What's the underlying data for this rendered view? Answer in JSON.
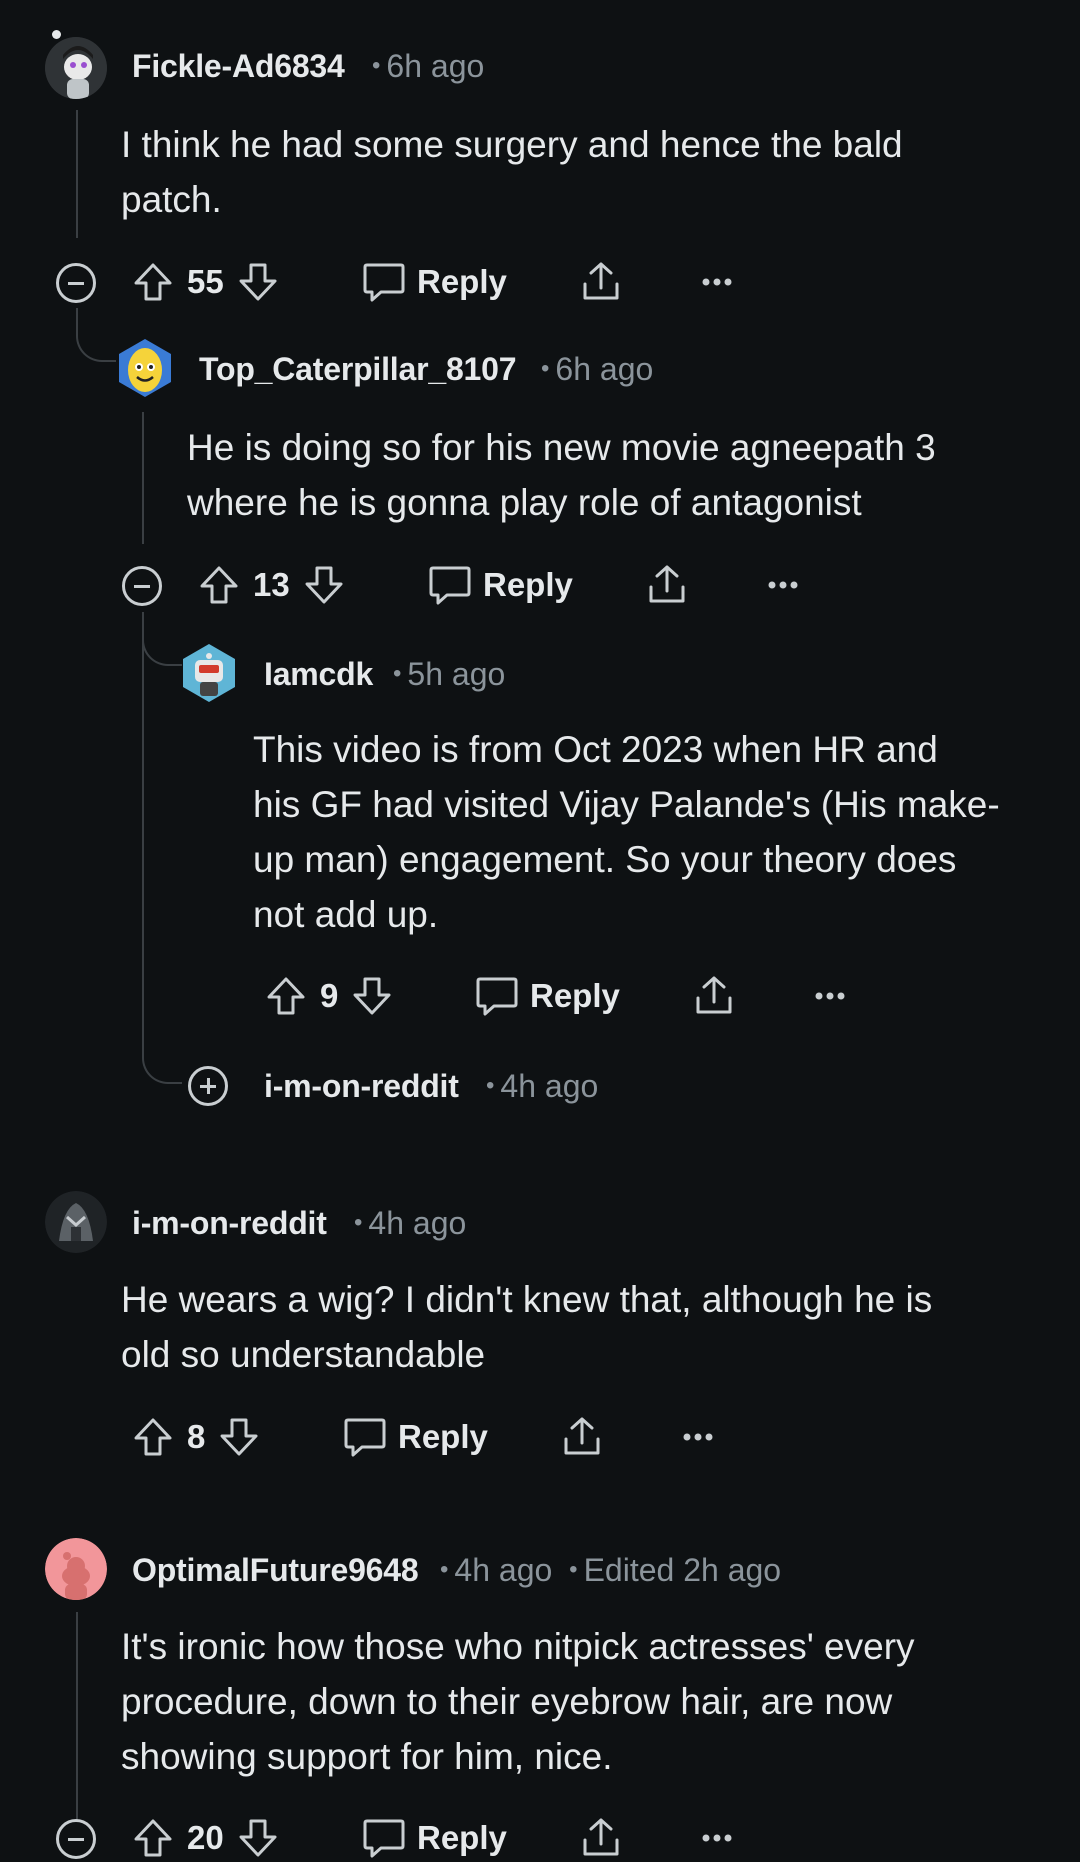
{
  "comments": [
    {
      "username": "Fickle-Ad6834",
      "time": "6h ago",
      "body_lines": [
        "I think he had some surgery and hence the bald",
        "patch."
      ],
      "votes": "55",
      "reply_label": "Reply"
    },
    {
      "username": "Top_Caterpillar_8107",
      "time": "6h ago",
      "body_lines": [
        "He is doing so for his new movie agneepath 3",
        "where he is gonna play role of antagonist"
      ],
      "votes": "13",
      "reply_label": "Reply"
    },
    {
      "username": "Iamcdk",
      "time": "5h ago",
      "body_lines": [
        "This video is from Oct 2023 when HR and",
        "his GF had visited Vijay Palande's (His make-",
        "up man) engagement. So your theory does",
        "not add up."
      ],
      "votes": "9",
      "reply_label": "Reply"
    },
    {
      "username": "i-m-on-reddit",
      "time": "4h ago",
      "collapsed": true
    },
    {
      "username": "i-m-on-reddit",
      "time": "4h ago",
      "body_lines": [
        "He wears a wig? I didn't knew that, although he is",
        "old so understandable"
      ],
      "votes": "8",
      "reply_label": "Reply"
    },
    {
      "username": "OptimalFuture9648",
      "time": "4h ago",
      "edited": "Edited 2h ago",
      "body_lines": [
        "It's ironic how those who nitpick actresses' every",
        "procedure, down to their eyebrow hair, are now",
        "showing support for him, nice."
      ],
      "votes": "20",
      "reply_label": "Reply"
    }
  ],
  "icons": {
    "upvote": "upvote-arrow-icon",
    "downvote": "downvote-arrow-icon",
    "reply": "speech-bubble-icon",
    "share": "share-upload-icon",
    "more": "ellipsis-icon",
    "collapse": "collapse-minus-icon",
    "expand": "expand-plus-icon"
  },
  "colors": {
    "background": "#0e1113",
    "text": "#e6e9eb",
    "meta": "#8b949b",
    "thread_line": "#3a3f43"
  }
}
